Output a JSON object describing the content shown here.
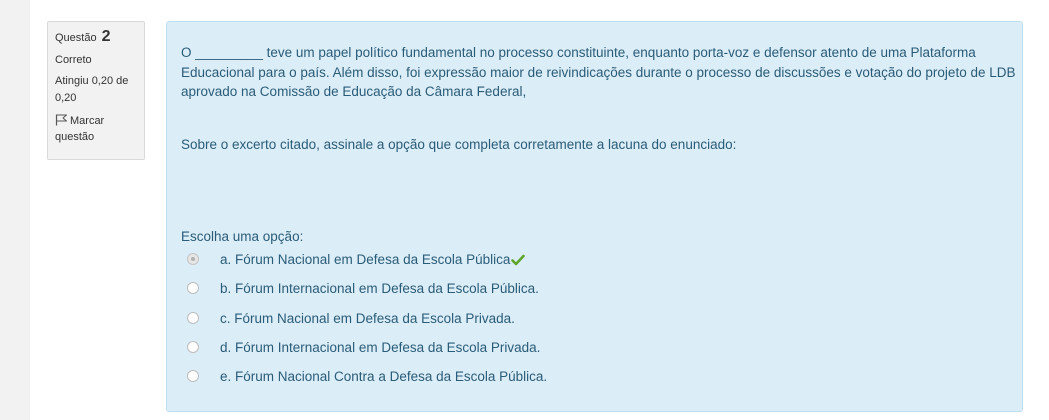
{
  "question": {
    "label": "Questão",
    "number": "2",
    "state": "Correto",
    "grade": "Atingiu 0,20 de 0,20",
    "flag_label": "Marcar questão",
    "text": "O _________ teve um papel político fundamental no processo constituinte, enquanto porta-voz e defensor atento de uma Plataforma Educacional para o país. Além disso, foi expressão maior de reivindicações durante o processo de discussões e votação do projeto de LDB aprovado na Comissão de Educação da Câmara Federal,",
    "prompt": "Sobre o excerto citado, assinale a opção que completa corretamente a lacuna do enunciado:",
    "answer_title": "Escolha uma opção:",
    "options": [
      {
        "label": "a. Fórum Nacional em Defesa da Escola Pública",
        "selected": true,
        "correct": true
      },
      {
        "label": "b. Fórum Internacional em Defesa da Escola Pública.",
        "selected": false
      },
      {
        "label": "c. Fórum Nacional em Defesa da Escola Privada.",
        "selected": false
      },
      {
        "label": "d. Fórum Internacional em Defesa da Escola Privada.",
        "selected": false
      },
      {
        "label": "e. Fórum Nacional Contra a Defesa da Escola Pública.",
        "selected": false
      }
    ]
  },
  "icons": {
    "flag": "flag-outline-icon",
    "correct": "checkmark-icon",
    "radio_checked": "radio-checked-icon",
    "radio": "radio-icon"
  },
  "colors": {
    "content_background": "#dbedf7",
    "content_border": "#bfdff0",
    "content_text": "#2a5c78",
    "info_background": "#f2f2f2",
    "check_green": "#5fa42b"
  }
}
